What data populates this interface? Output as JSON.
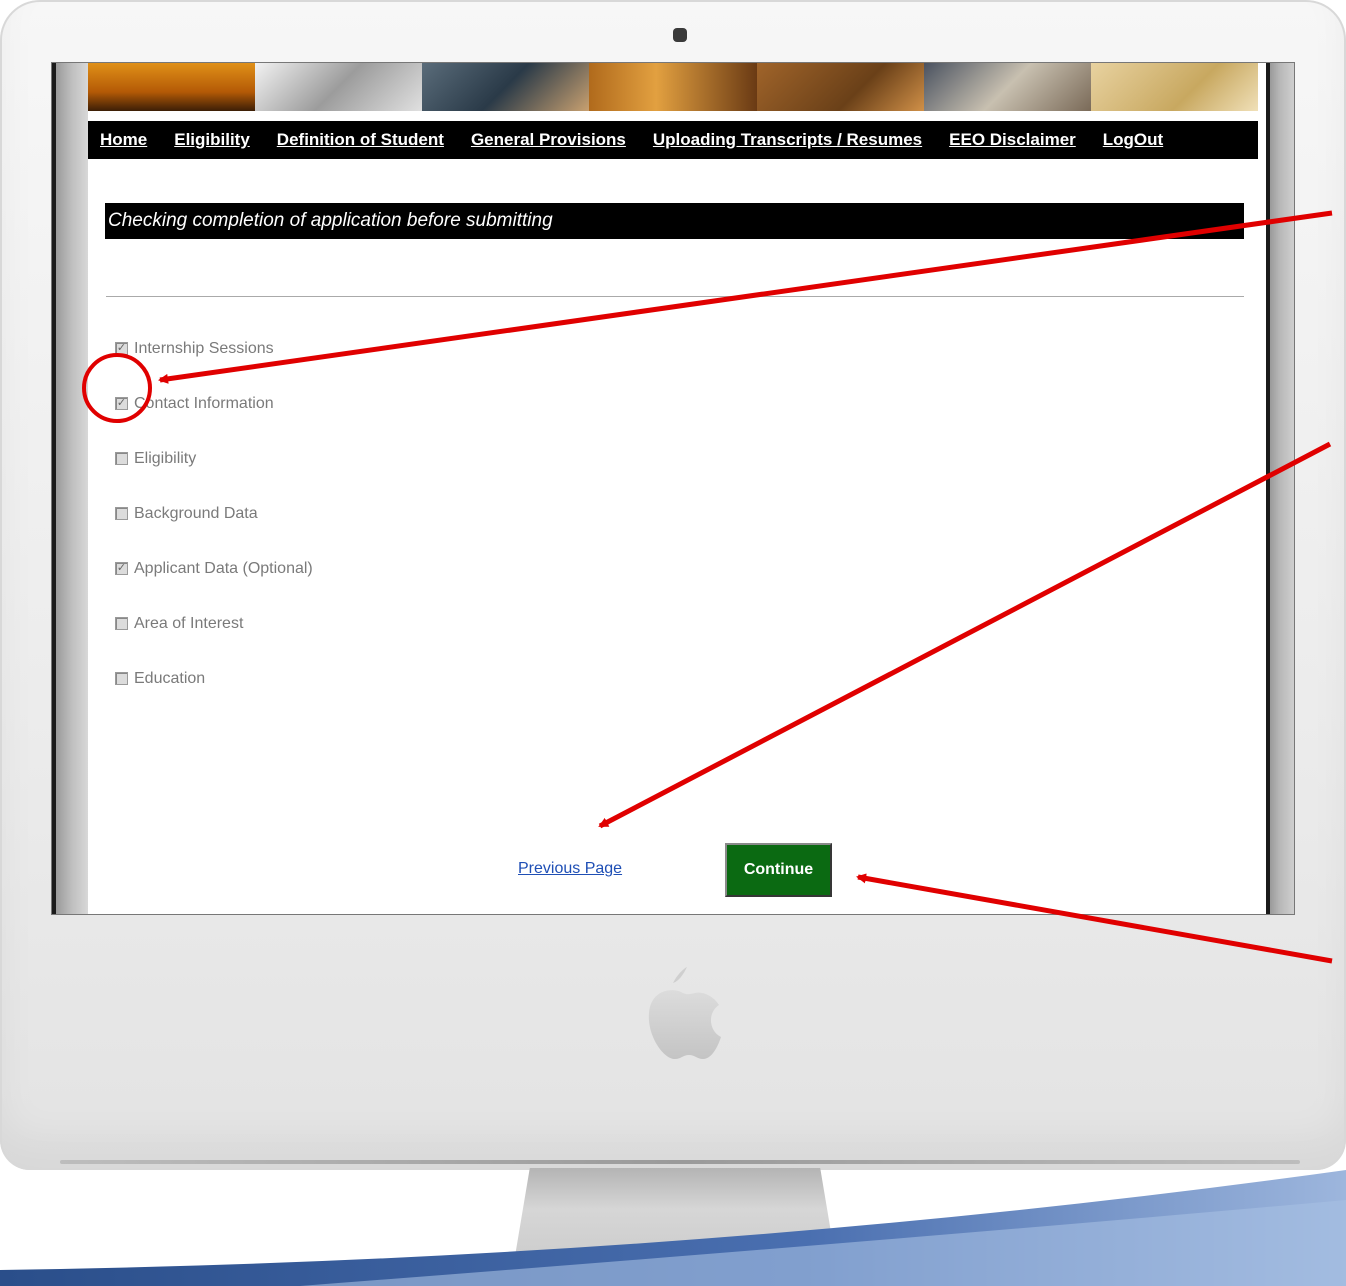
{
  "nav": {
    "items": [
      {
        "label": "Home"
      },
      {
        "label": "Eligibility"
      },
      {
        "label": "Definition of Student"
      },
      {
        "label": "General Provisions"
      },
      {
        "label": "Uploading Transcripts / Resumes"
      },
      {
        "label": "EEO Disclaimer"
      },
      {
        "label": "LogOut"
      }
    ]
  },
  "page": {
    "heading": "Checking completion of application before submitting"
  },
  "checklist": [
    {
      "label": "Internship Sessions",
      "checked": true
    },
    {
      "label": "Contact Information",
      "checked": true
    },
    {
      "label": "Eligibility",
      "checked": false
    },
    {
      "label": "Background Data",
      "checked": false
    },
    {
      "label": "Applicant Data (Optional)",
      "checked": true
    },
    {
      "label": "Area of Interest",
      "checked": false
    },
    {
      "label": "Education",
      "checked": false
    }
  ],
  "actions": {
    "previous_label": "Previous Page",
    "continue_label": "Continue"
  },
  "colors": {
    "nav_bg": "#000000",
    "continue_bg": "#0b6a12",
    "link": "#1f4fb5",
    "annotation": "#e00000"
  },
  "icons": {
    "annotation_circle": "highlight-circle",
    "annotation_arrows": "arrow"
  }
}
